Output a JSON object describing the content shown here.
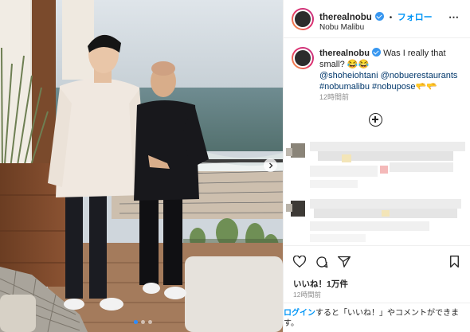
{
  "post": {
    "username": "therealnobu",
    "follow_label": "フォロー",
    "follow_separator": "•",
    "location": "Nobu Malibu",
    "more_icon": "⋯"
  },
  "caption": {
    "username": "therealnobu",
    "text": " Was I really that small? 😂😂",
    "mentions": "@shoheiohtani @nobuerestaurants",
    "hashtags": "#nobumalibu #nobupose",
    "hashtags_emoji": "🫳🫳",
    "time": "12時間前"
  },
  "engagement": {
    "likes": "いいね！1万件",
    "time": "12時間前"
  },
  "login_prompt": {
    "link": "ログイン",
    "text": "すると「いいね！」やコメントができます。"
  },
  "icons": {
    "like": "heart-icon",
    "comment": "comment-icon",
    "share": "paper-plane-icon",
    "save": "bookmark-icon",
    "load_more": "plus-circle-icon",
    "carousel": "chevron-right-icon"
  },
  "colors": {
    "accent": "#0095f6",
    "verified": "#3897f0",
    "hashtag": "#00376b",
    "muted": "#8e8e8e"
  },
  "carousel": {
    "count": 3,
    "active_index": 1
  }
}
